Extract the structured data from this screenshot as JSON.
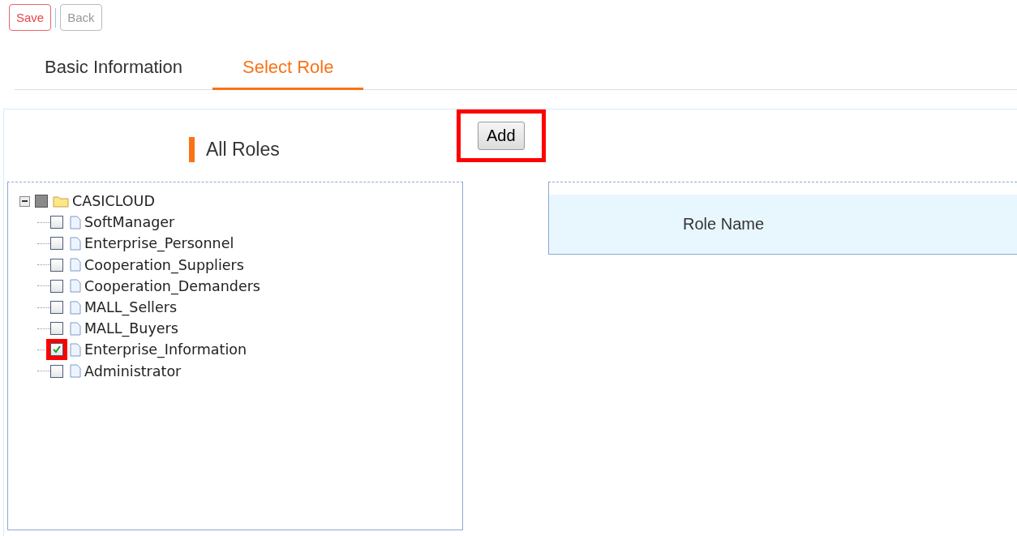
{
  "toolbar": [
    {
      "label": "Save",
      "kind": "primary"
    },
    {
      "label": "Back",
      "kind": "default"
    }
  ],
  "tabs": [
    {
      "label": "Basic Information",
      "selected": false
    },
    {
      "label": "Select Role",
      "selected": true
    }
  ],
  "panel_title": "All Roles",
  "add_button": {
    "label": "Add",
    "highlighted": true
  },
  "tree": {
    "label": "CASICLOUD",
    "expanded": true,
    "checked": false,
    "partial": true,
    "children": [
      {
        "label": "SoftManager",
        "checked": false,
        "highlighted": false
      },
      {
        "label": "Enterprise_Personnel",
        "checked": false,
        "highlighted": false
      },
      {
        "label": "Cooperation_Suppliers",
        "checked": false,
        "highlighted": false
      },
      {
        "label": "Cooperation_Demanders",
        "checked": false,
        "highlighted": false
      },
      {
        "label": "MALL_Sellers",
        "checked": false,
        "highlighted": false
      },
      {
        "label": "MALL_Buyers",
        "checked": false,
        "highlighted": false
      },
      {
        "label": "Enterprise_Information",
        "checked": true,
        "highlighted": true
      },
      {
        "label": "Administrator",
        "checked": false,
        "highlighted": false
      }
    ]
  },
  "table": {
    "columns": [
      "Role Name"
    ]
  }
}
